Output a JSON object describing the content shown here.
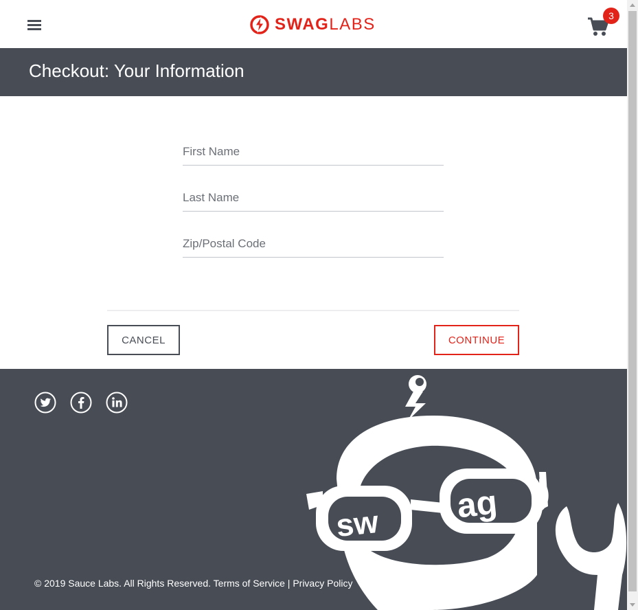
{
  "header": {
    "logo_bold": "SWAG",
    "logo_light": "LABS",
    "cart_count": "3"
  },
  "page": {
    "title": "Checkout: Your Information"
  },
  "form": {
    "first_name_placeholder": "First Name",
    "last_name_placeholder": "Last Name",
    "postal_code_placeholder": "Zip/Postal Code",
    "first_name_value": "",
    "last_name_value": "",
    "postal_code_value": ""
  },
  "actions": {
    "cancel_label": "CANCEL",
    "continue_label": "CONTINUE"
  },
  "footer": {
    "social_icons": [
      "twitter-icon",
      "facebook-icon",
      "linkedin-icon"
    ],
    "copyright": "© 2019 Sauce Labs. All Rights Reserved. Terms of Service | Privacy Policy",
    "robot_glasses_text_left": "sw",
    "robot_glasses_text_right": "ag"
  },
  "colors": {
    "brand_red": "#e2231a",
    "dark": "#474c55"
  }
}
